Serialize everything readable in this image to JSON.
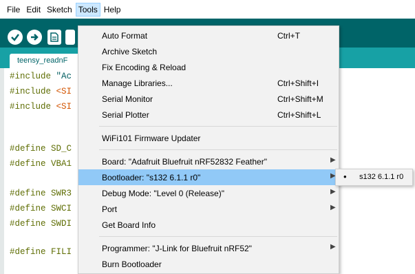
{
  "menubar": {
    "items": [
      "File",
      "Edit",
      "Sketch",
      "Tools",
      "Help"
    ],
    "active": "Tools"
  },
  "toolbar": {
    "buttons": [
      "verify-icon",
      "upload-icon",
      "new-icon"
    ],
    "background": "#006468"
  },
  "tabs": {
    "active_label": "teensy_readnF"
  },
  "editor": {
    "lines": [
      {
        "kw": "#include ",
        "rest": "\"Ac",
        "cls": "str"
      },
      {
        "kw": "#include ",
        "rest": "<SI",
        "cls": "hdr"
      },
      {
        "kw": "#include ",
        "rest": "<SI",
        "cls": "hdr"
      },
      {
        "kw": "#define ",
        "rest": "SD_C",
        "cls": ""
      },
      {
        "kw": "#define ",
        "rest": "VBA1",
        "cls": ""
      },
      {
        "kw": "#define ",
        "rest": "SWR3",
        "cls": ""
      },
      {
        "kw": "#define ",
        "rest": "SWCI",
        "cls": ""
      },
      {
        "kw": "#define ",
        "rest": "SWDI",
        "cls": ""
      },
      {
        "kw": "#define ",
        "rest": "FILI",
        "cls": ""
      }
    ]
  },
  "tools_menu": {
    "items": [
      {
        "label": "Auto Format",
        "shortcut": "Ctrl+T"
      },
      {
        "label": "Archive Sketch",
        "shortcut": ""
      },
      {
        "label": "Fix Encoding & Reload",
        "shortcut": ""
      },
      {
        "label": "Manage Libraries...",
        "shortcut": "Ctrl+Shift+I"
      },
      {
        "label": "Serial Monitor",
        "shortcut": "Ctrl+Shift+M"
      },
      {
        "label": "Serial Plotter",
        "shortcut": "Ctrl+Shift+L"
      },
      {
        "label": "WiFi101 Firmware Updater",
        "shortcut": ""
      },
      {
        "label": "Board: \"Adafruit Bluefruit nRF52832 Feather\"",
        "shortcut": "",
        "submenu": true
      },
      {
        "label": "Bootloader: \"s132 6.1.1 r0\"",
        "shortcut": "",
        "submenu": true,
        "highlighted": true
      },
      {
        "label": "Debug Mode: \"Level 0 (Release)\"",
        "shortcut": "",
        "submenu": true
      },
      {
        "label": "Port",
        "shortcut": "",
        "submenu": true
      },
      {
        "label": "Get Board Info",
        "shortcut": ""
      },
      {
        "label": "Programmer: \"J-Link for Bluefruit nRF52\"",
        "shortcut": "",
        "submenu": true
      },
      {
        "label": "Burn Bootloader",
        "shortcut": ""
      }
    ],
    "highlight_color": "#91c9f7"
  },
  "bootloader_submenu": {
    "items": [
      {
        "label": "s132 6.1.1 r0",
        "selected": true,
        "marker": "•"
      }
    ]
  }
}
